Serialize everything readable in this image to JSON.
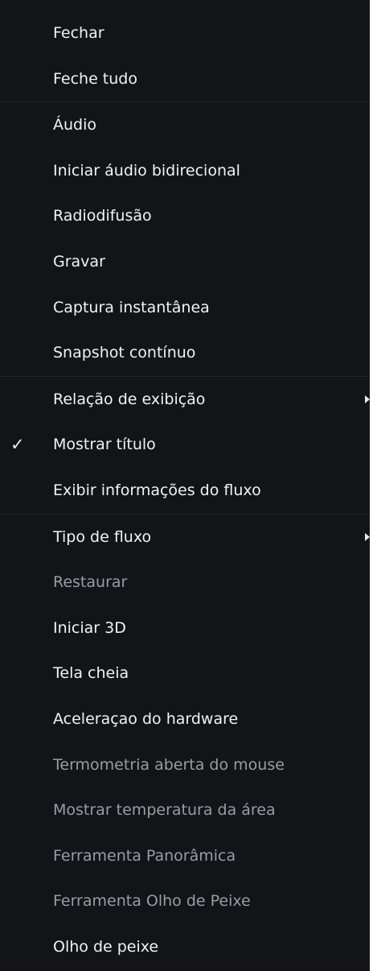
{
  "menu": {
    "items": [
      {
        "label": "Fechar"
      },
      {
        "label": "Feche tudo"
      },
      {
        "label": "Áudio"
      },
      {
        "label": "Iniciar áudio bidirecional"
      },
      {
        "label": "Radiodifusão"
      },
      {
        "label": "Gravar"
      },
      {
        "label": "Captura instantânea"
      },
      {
        "label": "Snapshot contínuo"
      },
      {
        "label": "Relação de exibição"
      },
      {
        "label": "Mostrar título",
        "check": "✓"
      },
      {
        "label": "Exibir informações do fluxo"
      },
      {
        "label": "Tipo de fluxo"
      },
      {
        "label": "Restaurar"
      },
      {
        "label": "Iniciar 3D"
      },
      {
        "label": "Tela cheia"
      },
      {
        "label": "Aceleraçao do hardware"
      },
      {
        "label": "Termometria aberta do mouse"
      },
      {
        "label": "Mostrar temperatura da área"
      },
      {
        "label": "Ferramenta Panorâmica"
      },
      {
        "label": "Ferramenta Olho de Peixe"
      },
      {
        "label": "Olho de peixe"
      }
    ]
  },
  "colors": {
    "menu_background": "#131418",
    "text_enabled": "#f2f2f2",
    "text_disabled": "#9a9ca3",
    "separator": "#24262c"
  }
}
